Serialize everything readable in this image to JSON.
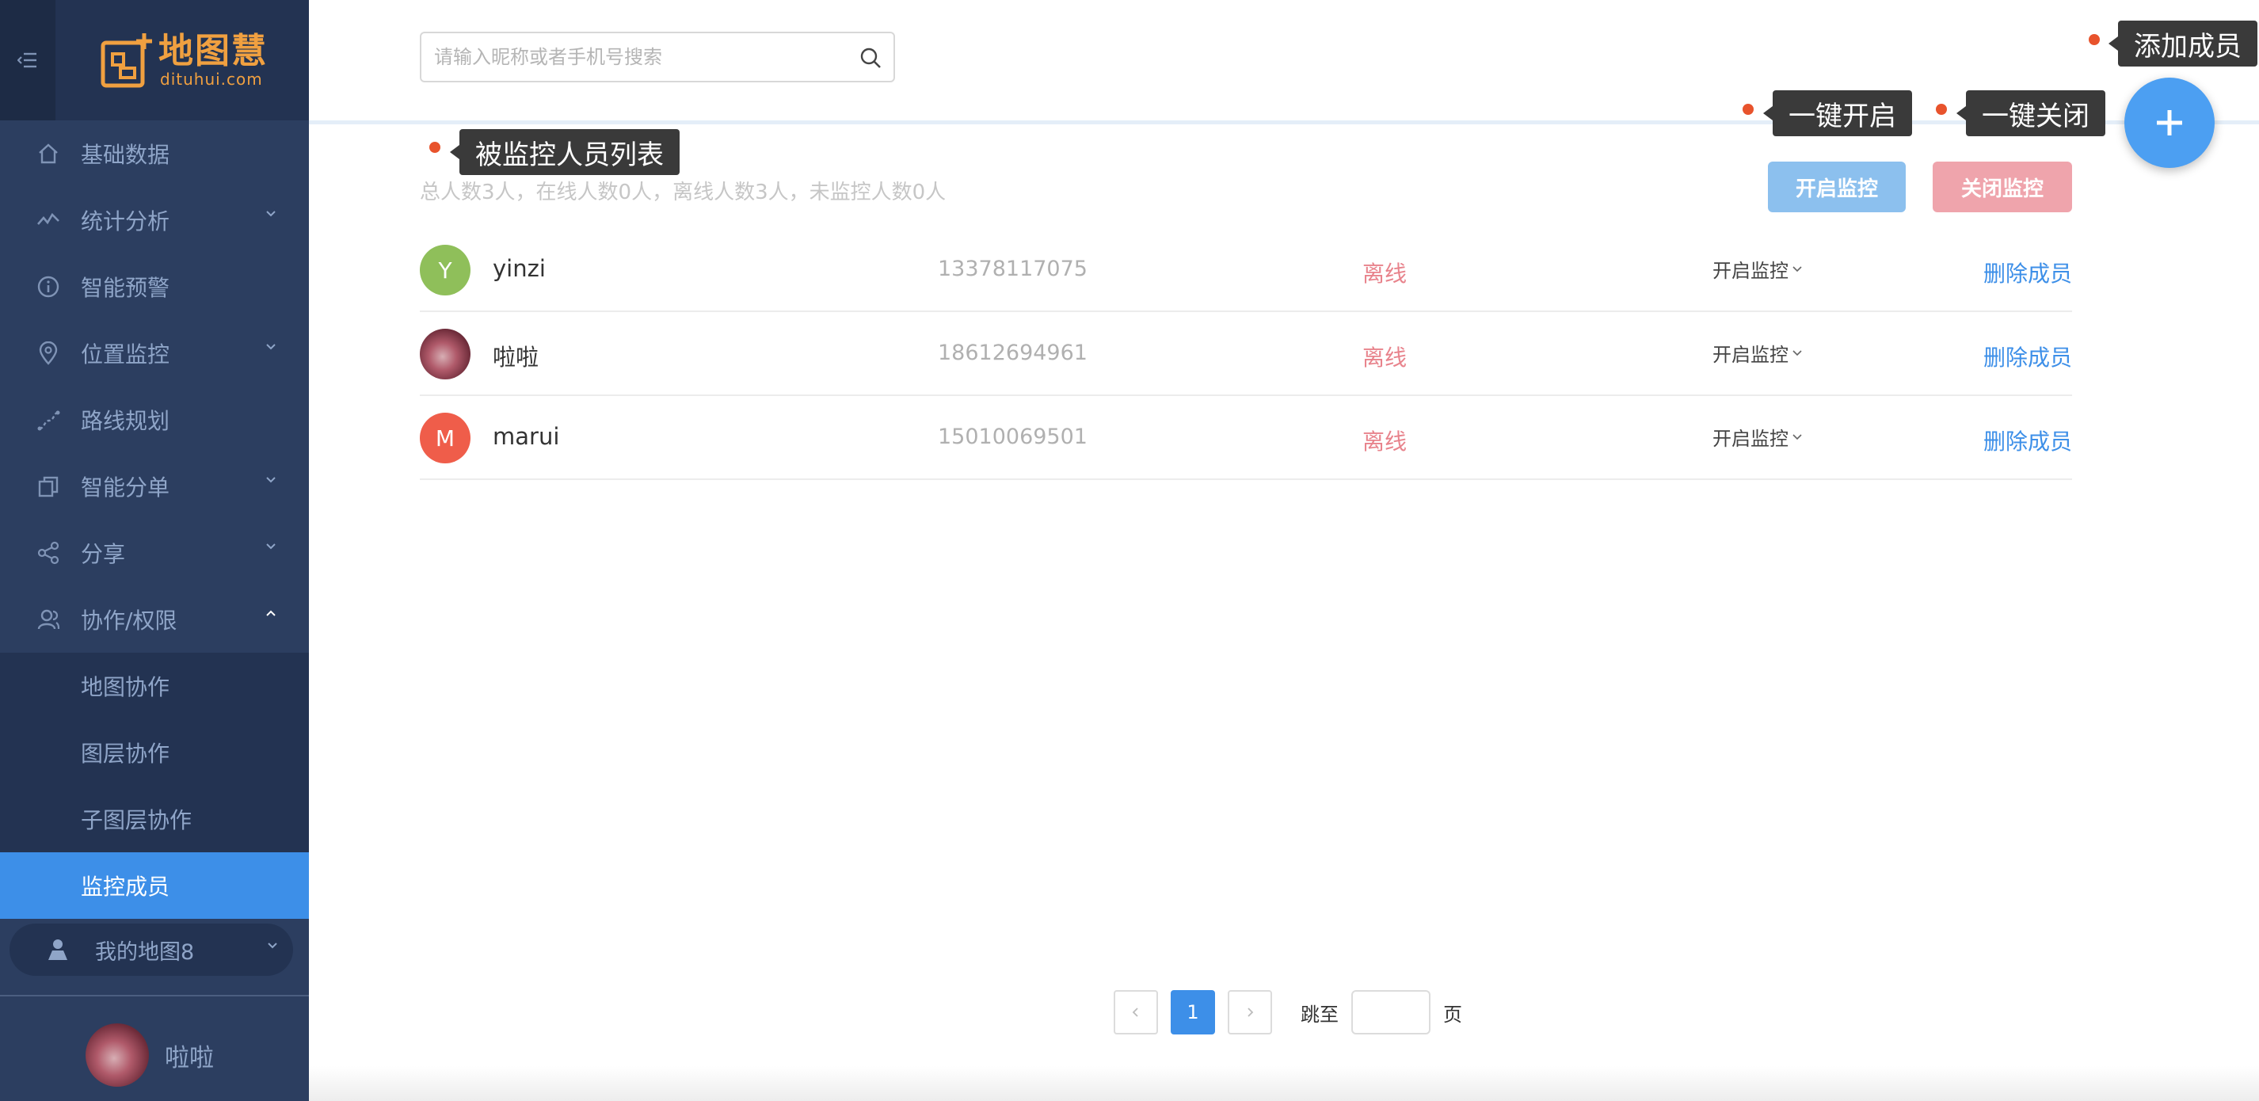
{
  "sidebar": {
    "logo": {
      "name": "地图慧",
      "domain": "dituhui.com"
    },
    "menu": [
      {
        "label": "基础数据",
        "icon": "home-icon"
      },
      {
        "label": "统计分析",
        "icon": "chart-icon"
      },
      {
        "label": "智能预警",
        "icon": "info-icon"
      },
      {
        "label": "位置监控",
        "icon": "location-icon"
      },
      {
        "label": "路线规划",
        "icon": "route-icon"
      },
      {
        "label": "智能分单",
        "icon": "copy-icon"
      },
      {
        "label": "分享",
        "icon": "share-icon"
      },
      {
        "label": "协作/权限",
        "icon": "user-icon"
      }
    ],
    "submenu": [
      {
        "label": "地图协作"
      },
      {
        "label": "图层协作"
      },
      {
        "label": "子图层协作"
      },
      {
        "label": "监控成员"
      }
    ],
    "map_selector": "我的地图8",
    "user_name": "啦啦"
  },
  "search": {
    "placeholder": "请输入昵称或者手机号搜索"
  },
  "summary": "总人数3人，在线人数0人，离线人数3人，未监控人数0人",
  "buttons": {
    "open": "开启监控",
    "close": "关闭监控"
  },
  "members": [
    {
      "avatar": "Y",
      "avatar_color": "#8fbf5a",
      "name": "yinzi",
      "phone": "13378117075",
      "status": "离线",
      "monitor": "开启监控",
      "action": "删除成员"
    },
    {
      "avatar": "",
      "avatar_color": "photo",
      "name": "啦啦",
      "phone": "18612694961",
      "status": "离线",
      "monitor": "开启监控",
      "action": "删除成员"
    },
    {
      "avatar": "M",
      "avatar_color": "#ef5d4a",
      "name": "marui",
      "phone": "15010069501",
      "status": "离线",
      "monitor": "开启监控",
      "action": "删除成员"
    }
  ],
  "pagination": {
    "current": "1",
    "jump_label": "跳至",
    "page_label": "页"
  },
  "annotations": {
    "add_member": "添加成员",
    "one_click_open": "一键开启",
    "one_click_close": "一键关闭",
    "monitored_list": "被监控人员列表"
  },
  "colors": {
    "accent": "#3d8fe8",
    "sidebar": "#2c3e60",
    "offline": "#e8838c",
    "annotation_dot": "#e8532c"
  }
}
